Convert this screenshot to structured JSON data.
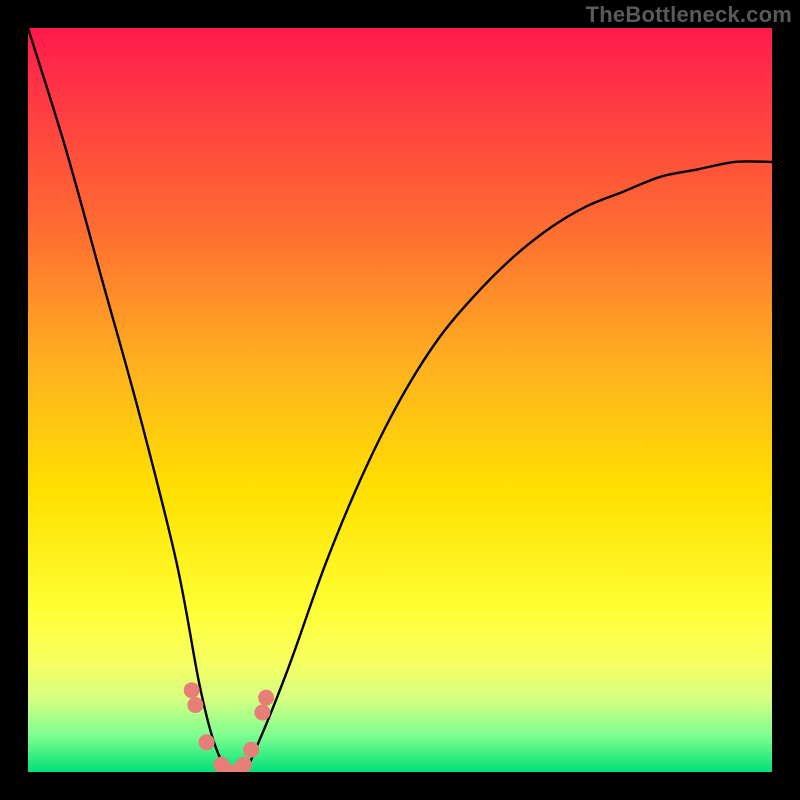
{
  "watermark": "TheBottleneck.com",
  "chart_data": {
    "type": "line",
    "title": "",
    "xlabel": "",
    "ylabel": "",
    "xlim": [
      0,
      100
    ],
    "ylim": [
      0,
      100
    ],
    "grid": false,
    "legend": false,
    "notes": "Bottleneck-style V curve over a vertical red→yellow→green gradient. No axis ticks or numeric labels are visible. Values below are approximate pixel-fraction readings of the black curve's height (0 = bottom, 100 = top) at evenly spaced x positions across the plot area.",
    "series": [
      {
        "name": "bottleneck-curve",
        "x": [
          0,
          5,
          10,
          15,
          20,
          23,
          25,
          27,
          29,
          31,
          35,
          40,
          45,
          50,
          55,
          60,
          65,
          70,
          75,
          80,
          85,
          90,
          95,
          100
        ],
        "values": [
          100,
          84,
          66,
          48,
          28,
          12,
          4,
          0,
          0,
          4,
          14,
          28,
          40,
          50,
          58,
          64,
          69,
          73,
          76,
          78,
          80,
          81,
          82,
          82
        ]
      }
    ],
    "markers": {
      "name": "highlight-dots",
      "color": "#e77e78",
      "points_xy": [
        [
          22,
          11
        ],
        [
          22.5,
          9
        ],
        [
          24,
          4
        ],
        [
          26,
          1
        ],
        [
          27,
          0
        ],
        [
          28,
          0
        ],
        [
          29,
          1
        ],
        [
          30,
          3
        ],
        [
          31.5,
          8
        ],
        [
          32,
          10
        ]
      ]
    },
    "gradient_stops": [
      {
        "pos": 0,
        "color": "#ff1a4d"
      },
      {
        "pos": 12,
        "color": "#ff4040"
      },
      {
        "pos": 28,
        "color": "#ff7030"
      },
      {
        "pos": 45,
        "color": "#ffb020"
      },
      {
        "pos": 62,
        "color": "#ffe000"
      },
      {
        "pos": 78,
        "color": "#ffff33"
      },
      {
        "pos": 85,
        "color": "#f7ff60"
      },
      {
        "pos": 90,
        "color": "#d8ff80"
      },
      {
        "pos": 95,
        "color": "#80ff90"
      },
      {
        "pos": 100,
        "color": "#00e078"
      }
    ]
  }
}
